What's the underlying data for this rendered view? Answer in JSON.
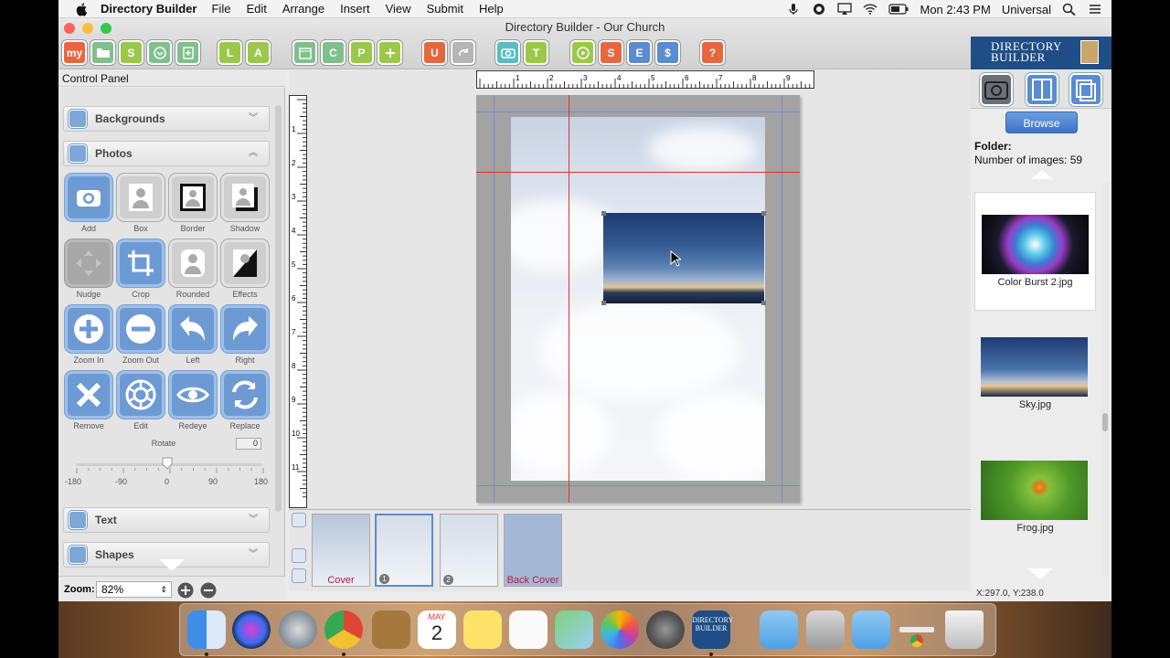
{
  "menubar": {
    "app_name": "Directory Builder",
    "menus": [
      "File",
      "Edit",
      "Arrange",
      "Insert",
      "View",
      "Submit",
      "Help"
    ],
    "clock": "Mon 2:43 PM",
    "user": "Universal"
  },
  "window": {
    "title": "Directory Builder - Our Church"
  },
  "toolbar": {
    "my_label": "my",
    "letters": [
      "S",
      "L",
      "A",
      "C",
      "C",
      "P",
      "U",
      "T",
      "S",
      "E",
      "$",
      "?"
    ],
    "logo_line1": "DIRECTORY",
    "logo_line2": "BUILDER"
  },
  "control_panel": {
    "header": "Control Panel",
    "sections": {
      "backgrounds": "Backgrounds",
      "photos": "Photos",
      "text": "Text",
      "shapes": "Shapes"
    },
    "tools": [
      {
        "label": "Add",
        "icon": "camera-icon"
      },
      {
        "label": "Box",
        "icon": "person-box-icon"
      },
      {
        "label": "Border",
        "icon": "person-border-icon"
      },
      {
        "label": "Shadow",
        "icon": "person-shadow-icon"
      },
      {
        "label": "Nudge",
        "icon": "nudge-arrows-icon"
      },
      {
        "label": "Crop",
        "icon": "crop-icon"
      },
      {
        "label": "Rounded",
        "icon": "person-rounded-icon"
      },
      {
        "label": "Effects",
        "icon": "effects-icon"
      },
      {
        "label": "Zoom In",
        "icon": "plus-icon"
      },
      {
        "label": "Zoom Out",
        "icon": "minus-icon"
      },
      {
        "label": "Left",
        "icon": "rotate-left-icon"
      },
      {
        "label": "Right",
        "icon": "rotate-right-icon"
      },
      {
        "label": "Remove",
        "icon": "x-icon"
      },
      {
        "label": "Edit",
        "icon": "aperture-icon"
      },
      {
        "label": "Redeye",
        "icon": "eye-icon"
      },
      {
        "label": "Replace",
        "icon": "replace-arrows-icon"
      }
    ],
    "rotate": {
      "label": "Rotate",
      "value": "0",
      "ticks": [
        "-180",
        "-90",
        "0",
        "90",
        "180"
      ]
    },
    "zoom": {
      "label": "Zoom:",
      "value": "82%"
    }
  },
  "rulers": {
    "top": [
      "1",
      "2",
      "3",
      "4",
      "5",
      "6",
      "7",
      "8",
      "9"
    ],
    "left": [
      "1",
      "2",
      "3",
      "4",
      "5",
      "6",
      "7",
      "8",
      "9",
      "10",
      "11"
    ]
  },
  "thumbnails": [
    {
      "caption": "Cover",
      "num": ""
    },
    {
      "caption": "",
      "num": "1"
    },
    {
      "caption": "",
      "num": "2"
    },
    {
      "caption": "Back Cover",
      "num": ""
    }
  ],
  "right_panel": {
    "browse_label": "Browse",
    "folder_label": "Folder:",
    "count_label": "Number of images: 59",
    "images": [
      {
        "name": "Color Burst 2.jpg"
      },
      {
        "name": "Sky.jpg"
      },
      {
        "name": "Frog.jpg"
      }
    ],
    "coords": "X:297.0, Y:238.0"
  },
  "dock": {
    "calendar_month": "MAY",
    "calendar_day": "2",
    "app_tile_line1": "DIRECTORY",
    "app_tile_line2": "BUILDER"
  }
}
